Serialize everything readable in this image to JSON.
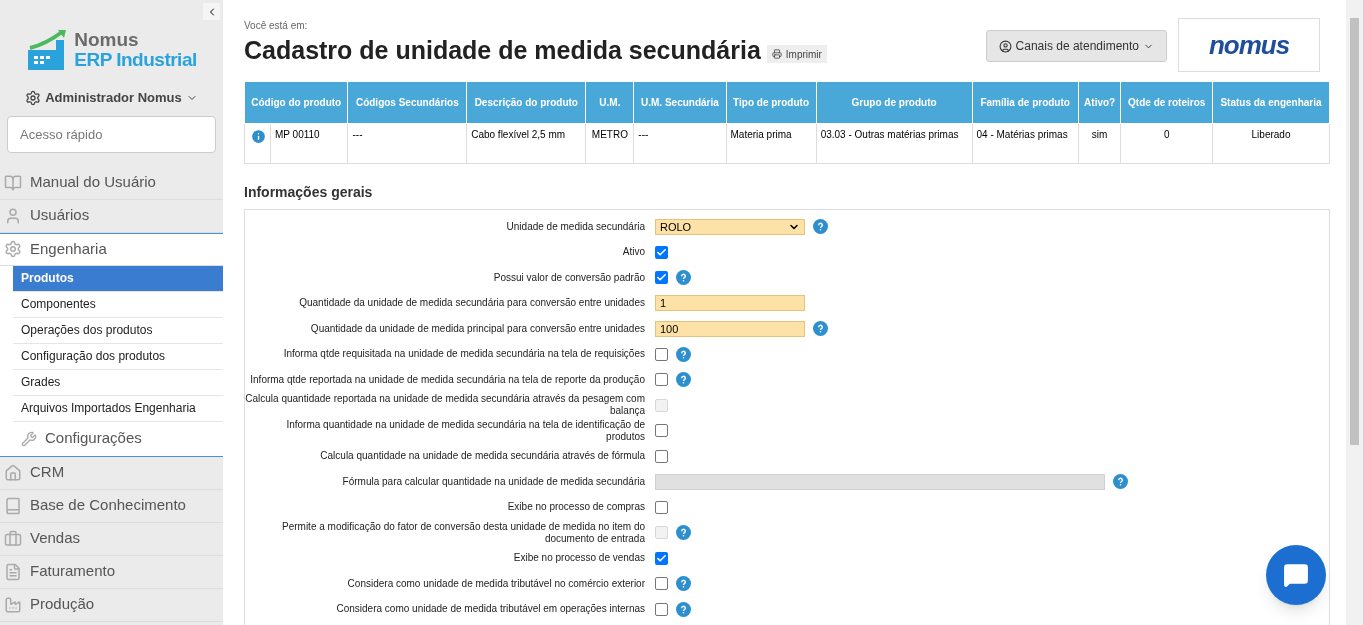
{
  "sidebar": {
    "brand": {
      "name": "Nomus",
      "product": "ERP Industrial"
    },
    "user": "Administrador Nomus",
    "quick_access": {
      "placeholder": "Acesso rápido"
    },
    "items": [
      {
        "kind": "book",
        "label": "Manual do Usuário",
        "expanded": false
      },
      {
        "kind": "user",
        "label": "Usuários",
        "expanded": false
      },
      {
        "kind": "gear",
        "label": "Engenharia",
        "expanded": true,
        "children": [
          {
            "label": "Produtos",
            "selected": true
          },
          {
            "label": "Componentes",
            "selected": false
          },
          {
            "label": "Operações dos produtos",
            "selected": false
          },
          {
            "label": "Configuração dos produtos",
            "selected": false
          },
          {
            "label": "Grades",
            "selected": false
          },
          {
            "label": "Arquivos Importados Engenharia",
            "selected": false
          }
        ],
        "footer": "Configurações"
      },
      {
        "kind": "home",
        "label": "CRM",
        "expanded": false
      },
      {
        "kind": "book2",
        "label": "Base de Conhecimento",
        "expanded": false
      },
      {
        "kind": "case",
        "label": "Vendas",
        "expanded": false
      },
      {
        "kind": "invoice",
        "label": "Faturamento",
        "expanded": false
      },
      {
        "kind": "factory",
        "label": "Produção",
        "expanded": false
      }
    ]
  },
  "header": {
    "breadcrumb": "Você está em:",
    "title": "Cadastro de unidade de medida secundária",
    "print": "Imprimir",
    "support": "Canais de atendimento",
    "logo": "nomus"
  },
  "table": {
    "columns": [
      "Código do produto",
      "Códigos Secundários",
      "Descrição do produto",
      "U.M.",
      "U.M. Secundária",
      "Tipo de produto",
      "Grupo de produto",
      "Família de produto",
      "Ativo?",
      "Qtde de roteiros",
      "Status da engenharia"
    ],
    "rows": [
      [
        "MP 00110",
        "---",
        "Cabo flexível 2,5 mm",
        "METRO",
        "---",
        "Materia prima",
        "03.03 - Outras matérias primas",
        "04 - Matérias primas",
        "sim",
        "0",
        "Liberado"
      ]
    ]
  },
  "section": "Informações gerais",
  "fields": [
    {
      "kind": "select",
      "label": "Unidade de medida secundária",
      "value": "ROLO",
      "help": true
    },
    {
      "kind": "checkbox",
      "label": "Ativo",
      "checked": true,
      "disabled": false,
      "help": false
    },
    {
      "kind": "checkbox",
      "label": "Possui valor de conversão padrão",
      "checked": true,
      "disabled": false,
      "help": true
    },
    {
      "kind": "text",
      "label": "Quantidade da unidade de medida secundária para conversão entre unidades",
      "value": "1",
      "help": false
    },
    {
      "kind": "text",
      "label": "Quantidade da unidade de medida principal para conversão entre unidades",
      "value": "100",
      "help": true
    },
    {
      "kind": "checkbox",
      "label": "Informa qtde requisitada na unidade de medida secundária na tela de requisições",
      "checked": false,
      "disabled": false,
      "help": true
    },
    {
      "kind": "checkbox",
      "label": "Informa qtde reportada na unidade de medida secundária na tela de reporte da produção",
      "checked": false,
      "disabled": false,
      "help": true
    },
    {
      "kind": "checkbox",
      "label": "Calcula quantidade reportada na unidade de medida secundária através da pesagem com balança",
      "checked": false,
      "disabled": true,
      "help": false
    },
    {
      "kind": "checkbox",
      "label": "Informa quantidade na unidade de medida secundária na tela de identificação de produtos",
      "checked": false,
      "disabled": false,
      "help": false
    },
    {
      "kind": "checkbox",
      "label": "Calcula quantidade na unidade de medida secundária através de fórmula",
      "checked": false,
      "disabled": false,
      "help": false
    },
    {
      "kind": "formula",
      "label": "Fórmula para calcular quantidade na unidade de medida secundária",
      "help": true
    },
    {
      "kind": "checkbox",
      "label": "Exibe no processo de compras",
      "checked": false,
      "disabled": false,
      "help": false
    },
    {
      "kind": "checkbox",
      "label": "Permite a modificação do fator de conversão desta unidade de medida no item do documento de entrada",
      "checked": false,
      "disabled": true,
      "help": true
    },
    {
      "kind": "checkbox",
      "label": "Exibe no processo de vendas",
      "checked": true,
      "disabled": false,
      "help": false
    },
    {
      "kind": "checkbox",
      "label": "Considera como unidade de medida tributável no comércio exterior",
      "checked": false,
      "disabled": false,
      "help": true
    },
    {
      "kind": "checkbox",
      "label": "Considera como unidade de medida tributável em operações internas",
      "checked": false,
      "disabled": false,
      "help": true
    }
  ]
}
